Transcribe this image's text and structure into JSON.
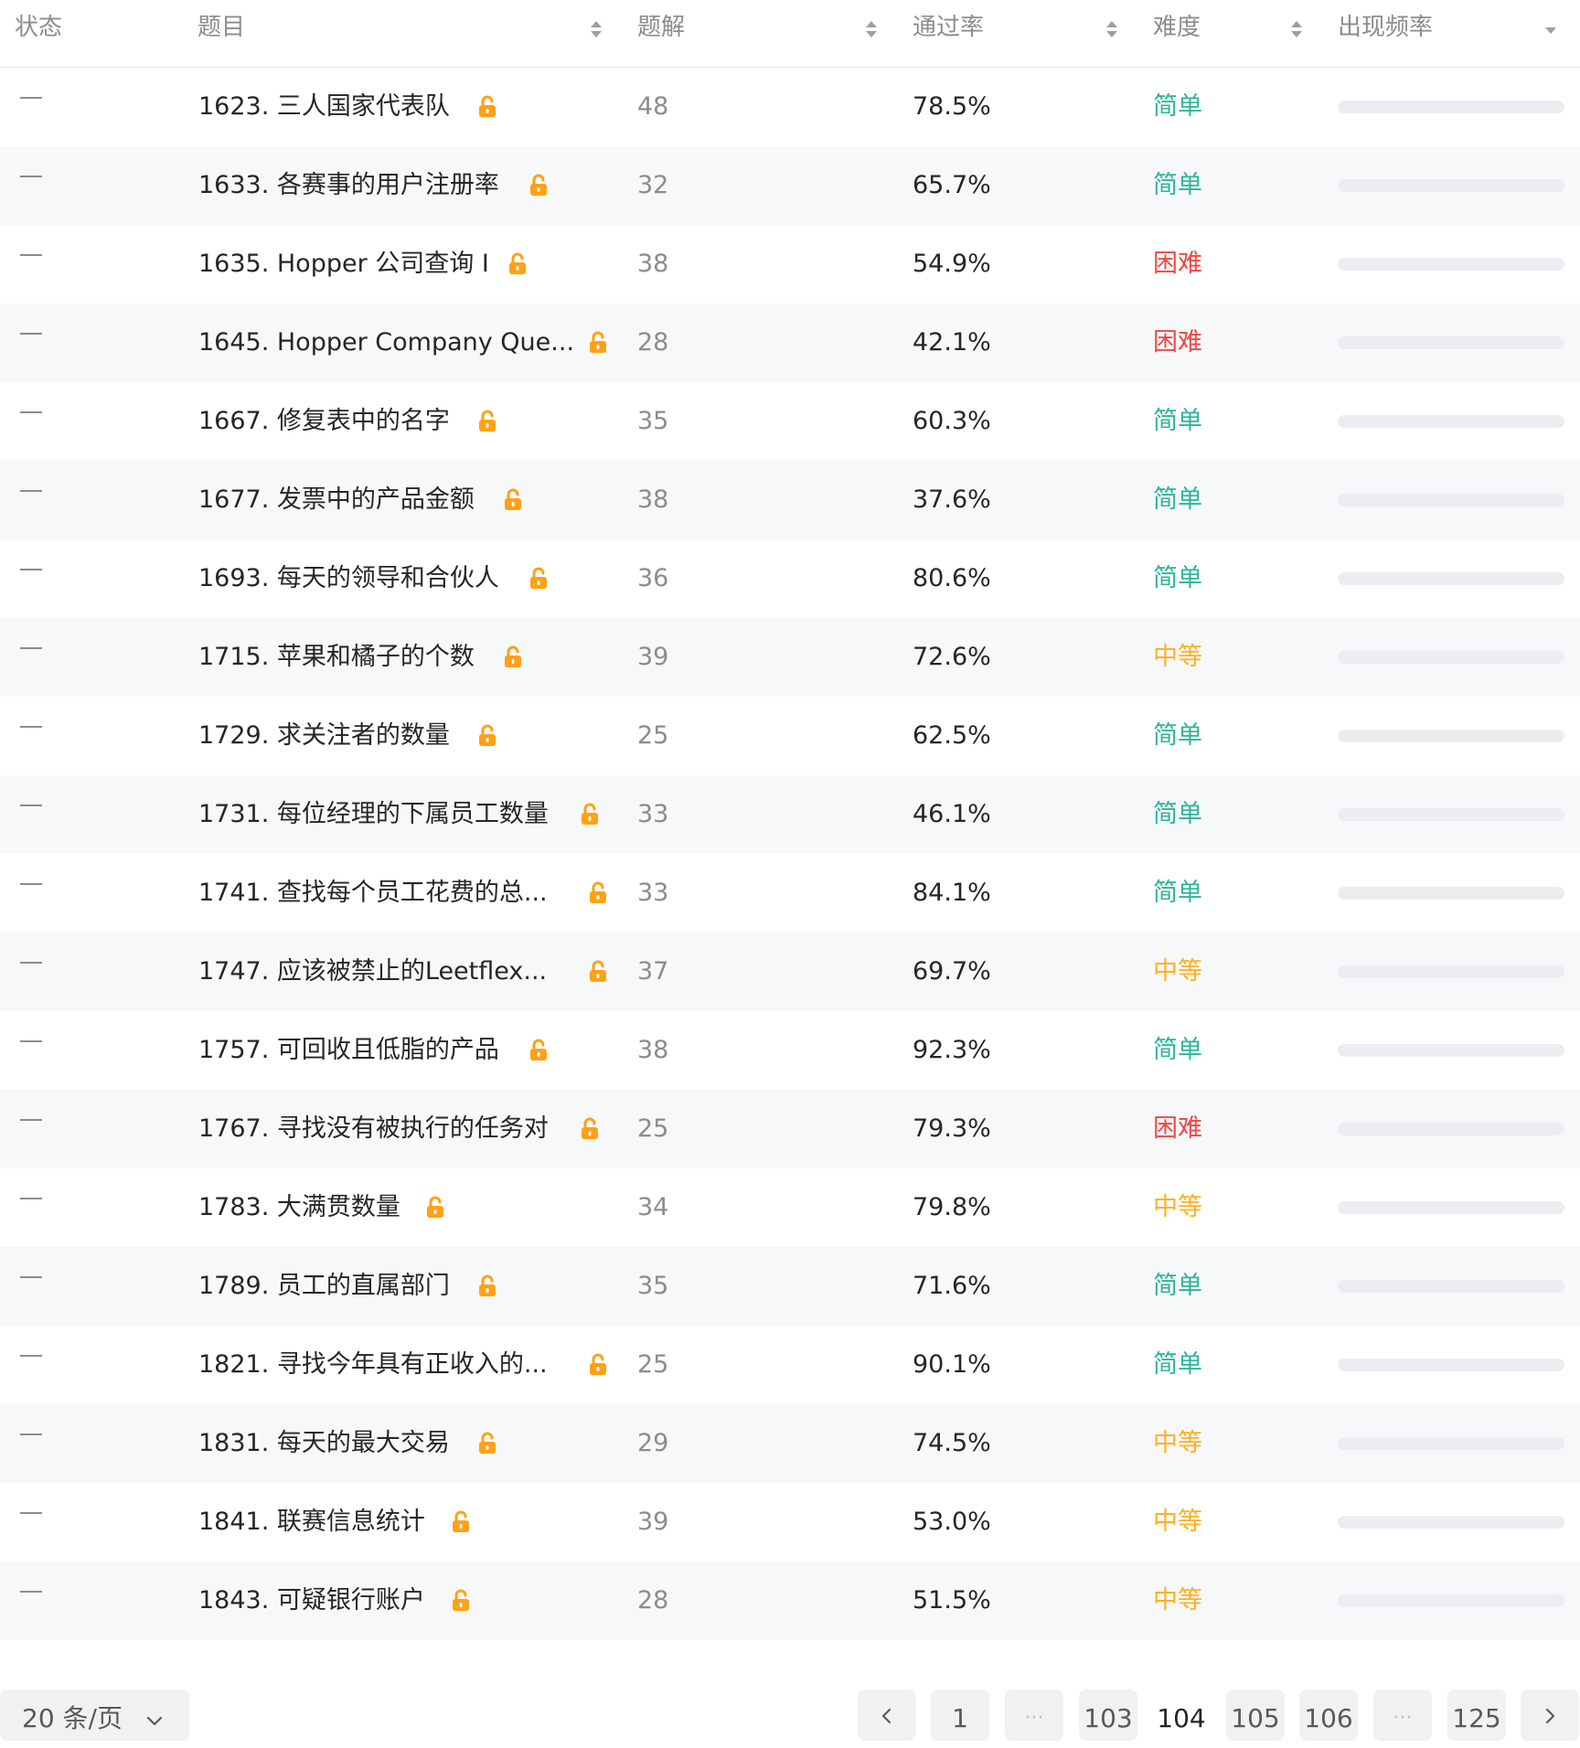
{
  "header": {
    "status": "状态",
    "title": "题目",
    "solutions": "题解",
    "acceptance": "通过率",
    "difficulty": "难度",
    "frequency": "出现频率"
  },
  "colors": {
    "easy": "#2db59a",
    "medium": "#ffb020",
    "hard": "#ef4743",
    "lock": "#ffa116"
  },
  "rows": [
    {
      "title": "1623. 三人国家代表队",
      "solutions": "48",
      "acceptance": "78.5%",
      "difficulty": "简单",
      "level": "easy"
    },
    {
      "title": "1633. 各赛事的用户注册率",
      "solutions": "32",
      "acceptance": "65.7%",
      "difficulty": "简单",
      "level": "easy"
    },
    {
      "title": "1635. Hopper 公司查询 I",
      "solutions": "38",
      "acceptance": "54.9%",
      "difficulty": "困难",
      "level": "hard"
    },
    {
      "title": "1645. Hopper Company Que...",
      "solutions": "28",
      "acceptance": "42.1%",
      "difficulty": "困难",
      "level": "hard"
    },
    {
      "title": "1667. 修复表中的名字",
      "solutions": "35",
      "acceptance": "60.3%",
      "difficulty": "简单",
      "level": "easy"
    },
    {
      "title": "1677. 发票中的产品金额",
      "solutions": "38",
      "acceptance": "37.6%",
      "difficulty": "简单",
      "level": "easy"
    },
    {
      "title": "1693. 每天的领导和合伙人",
      "solutions": "36",
      "acceptance": "80.6%",
      "difficulty": "简单",
      "level": "easy"
    },
    {
      "title": "1715. 苹果和橘子的个数",
      "solutions": "39",
      "acceptance": "72.6%",
      "difficulty": "中等",
      "level": "medium"
    },
    {
      "title": "1729. 求关注者的数量",
      "solutions": "25",
      "acceptance": "62.5%",
      "difficulty": "简单",
      "level": "easy"
    },
    {
      "title": "1731. 每位经理的下属员工数量",
      "solutions": "33",
      "acceptance": "46.1%",
      "difficulty": "简单",
      "level": "easy"
    },
    {
      "title": "1741. 查找每个员工花费的总...",
      "solutions": "33",
      "acceptance": "84.1%",
      "difficulty": "简单",
      "level": "easy"
    },
    {
      "title": "1747. 应该被禁止的Leetflex...",
      "solutions": "37",
      "acceptance": "69.7%",
      "difficulty": "中等",
      "level": "medium"
    },
    {
      "title": "1757. 可回收且低脂的产品",
      "solutions": "38",
      "acceptance": "92.3%",
      "difficulty": "简单",
      "level": "easy"
    },
    {
      "title": "1767. 寻找没有被执行的任务对",
      "solutions": "25",
      "acceptance": "79.3%",
      "difficulty": "困难",
      "level": "hard"
    },
    {
      "title": "1783. 大满贯数量",
      "solutions": "34",
      "acceptance": "79.8%",
      "difficulty": "中等",
      "level": "medium"
    },
    {
      "title": "1789. 员工的直属部门",
      "solutions": "35",
      "acceptance": "71.6%",
      "difficulty": "简单",
      "level": "easy"
    },
    {
      "title": "1821. 寻找今年具有正收入的...",
      "solutions": "25",
      "acceptance": "90.1%",
      "difficulty": "简单",
      "level": "easy"
    },
    {
      "title": "1831. 每天的最大交易",
      "solutions": "29",
      "acceptance": "74.5%",
      "difficulty": "中等",
      "level": "medium"
    },
    {
      "title": "1841. 联赛信息统计",
      "solutions": "39",
      "acceptance": "53.0%",
      "difficulty": "中等",
      "level": "medium"
    },
    {
      "title": "1843. 可疑银行账户",
      "solutions": "28",
      "acceptance": "51.5%",
      "difficulty": "中等",
      "level": "medium"
    }
  ],
  "pagination": {
    "page_size": "20 条/页",
    "pages": [
      "1",
      "···",
      "103",
      "104",
      "105",
      "106",
      "···",
      "125"
    ],
    "current": "104"
  }
}
